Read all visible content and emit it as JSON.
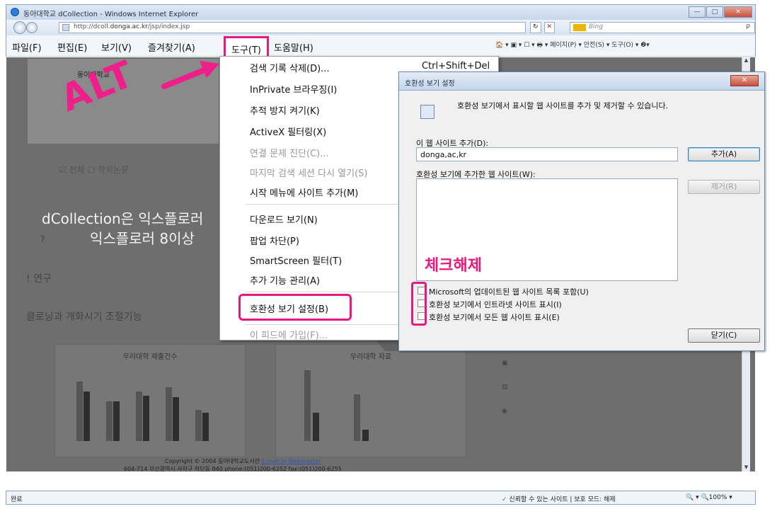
{
  "window": {
    "title": "동아대학교 dCollection - Windows Internet Explorer",
    "url_prefix": "http://dcoll.",
    "url_domain": "donga.ac.kr",
    "url_suffix": "/jsp/index.jsp",
    "search_placeholder": "Bing",
    "search_icon": "ρ",
    "minimize": "—",
    "maximize": "□",
    "close": "✕",
    "refresh": "↻",
    "stop": "✕"
  },
  "menubar": {
    "items": [
      "파일(F)",
      "편집(E)",
      "보기(V)",
      "즐겨찾기(A)",
      "도구(T)",
      "도움말(H)"
    ],
    "command_bar": "🏠 ▾  ▣ ▾  ☐ ▾  🖶 ▾  페이지(P) ▾  안전(S) ▾  도구(O) ▾  ❷▾"
  },
  "page": {
    "logo_text": "동아대학교",
    "check_all": "☑ 전체    ☐ 학위논문",
    "intro_line1": "dCollection은 익스플로러",
    "intro_line2": "익스플로러 8이상",
    "question_mark": "?",
    "research": "! 연구",
    "cloning": "클로닝과 개화시기 조절기능",
    "chart1_title": "우리대학 제출건수",
    "chart2_title": "우리대학 자료",
    "footer_line1_text": "Copyright © 2004 동아대학교도서관 ",
    "footer_line1_link": "E-mail to Webmaster",
    "footer_line2": "604-714 부산광역시 사하구 하단동 840 phone:(051)200-6252 fax:(051)200-6255"
  },
  "statusbar": {
    "left": "완료",
    "zone_check": "✓",
    "zone": "신뢰할 수 있는 사이트 | 보호 모드: 해제",
    "zoom": "🔍 ▾  🔍100% ▾"
  },
  "tools_menu": {
    "items": [
      {
        "label": "검색 기록 삭제(D)...",
        "shortcut": "Ctrl+Shift+Del",
        "disabled": false
      },
      {
        "label": "InPrivate 브라우징(I)",
        "disabled": false
      },
      {
        "label": "추적 방지 켜기(K)",
        "disabled": false
      },
      {
        "label": "ActiveX 필터링(X)",
        "disabled": false
      },
      {
        "label": "연결 문제 진단(C)...",
        "disabled": true
      },
      {
        "label": "마지막 검색 세션 다시 열기(S)",
        "disabled": true
      },
      {
        "label": "시작 메뉴에 사이트 추가(M)",
        "disabled": false
      },
      {
        "label": "다운로드 보기(N)",
        "disabled": false
      },
      {
        "label": "팝업 차단(P)",
        "disabled": false
      },
      {
        "label": "SmartScreen 필터(T)",
        "disabled": false
      },
      {
        "label": "추가 기능 관리(A)",
        "disabled": false
      },
      {
        "label": "호환성 보기 설정(B)",
        "disabled": false
      },
      {
        "label": "이 피드에 가입(F)...",
        "disabled": true
      }
    ]
  },
  "dialog": {
    "title": "호환성 보기 설정",
    "close": "✕",
    "description": "호환성 보기에서 표시할 웹 사이트를 추가 및 제거할 수 있습니다.",
    "add_label": "이 웹 사이트 추가(D):",
    "add_value": "donga,ac,kr",
    "add_button": "추가(A)",
    "list_label": "호환성 보기에 추가한 웹 사이트(W):",
    "remove_button": "제거(R)",
    "options": [
      {
        "label": "Microsoft의 업데이트된 웹 사이트 목록 포함(U)",
        "checked": false
      },
      {
        "label": "호환성 보기에서 인트라넷 사이트 표시(I)",
        "checked": false
      },
      {
        "label": "호환성 보기에서 모든 웹 사이트 표시(E)",
        "checked": false
      }
    ],
    "close_button": "닫기(C)"
  },
  "annotations": {
    "alt": "ALT",
    "uncheck": "체크해제",
    "color": "#e6197e"
  }
}
